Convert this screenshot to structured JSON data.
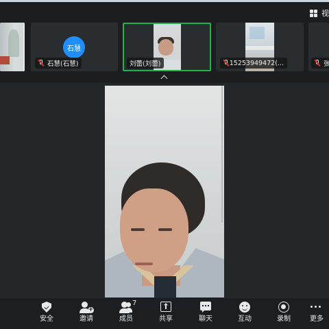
{
  "topbar": {
    "view_label": "视"
  },
  "participants": [
    {
      "name": ""
    },
    {
      "name": "石慧(石慧)",
      "avatar_text": "石慧",
      "avatar_color": "#1f8fff"
    },
    {
      "name": "刘蕾(刘蕾)",
      "active_speaker": true,
      "highlight_color": "#22b34a"
    },
    {
      "name": "15253949472(..."
    },
    {
      "name": "张"
    }
  ],
  "toolbar": {
    "security": "安全",
    "invite": "邀请",
    "members": "成员",
    "members_count": "7",
    "share": "共享",
    "chat": "聊天",
    "interact": "互动",
    "record": "录制",
    "more": "更多"
  }
}
